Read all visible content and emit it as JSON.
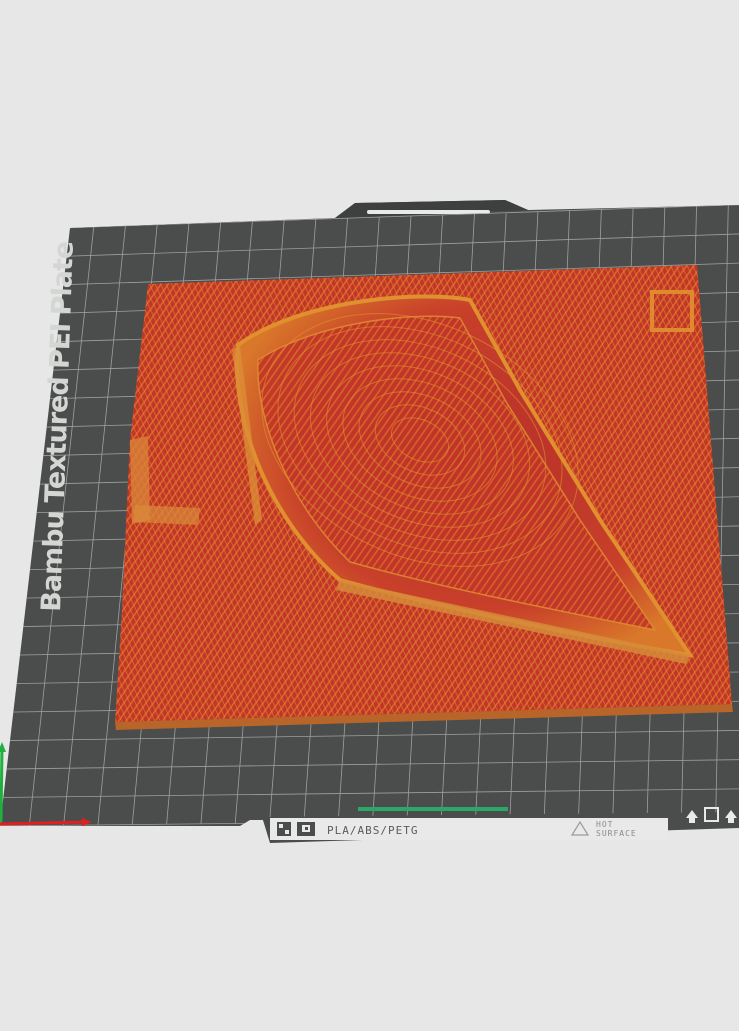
{
  "viewport": {
    "background": "#e6e7e6"
  },
  "build_plate": {
    "label": "Bambu Textured PEI Plate",
    "plate_color": "#4a4d4c",
    "grid_color": "#9da09f"
  },
  "model": {
    "color_primary": "#c3342a",
    "color_secondary": "#d9781e"
  },
  "bottom_strip": {
    "material": "PLA/ABS/PETG",
    "warning_line1": "HOT",
    "warning_line2": "SURFACE",
    "icons": [
      "plate-qr-icon",
      "plate-type-icon",
      "up-arrow-icon",
      "square-icon",
      "up-arrow-icon"
    ]
  },
  "axes": {
    "x_color": "#e02020",
    "y_color": "#20b040"
  }
}
